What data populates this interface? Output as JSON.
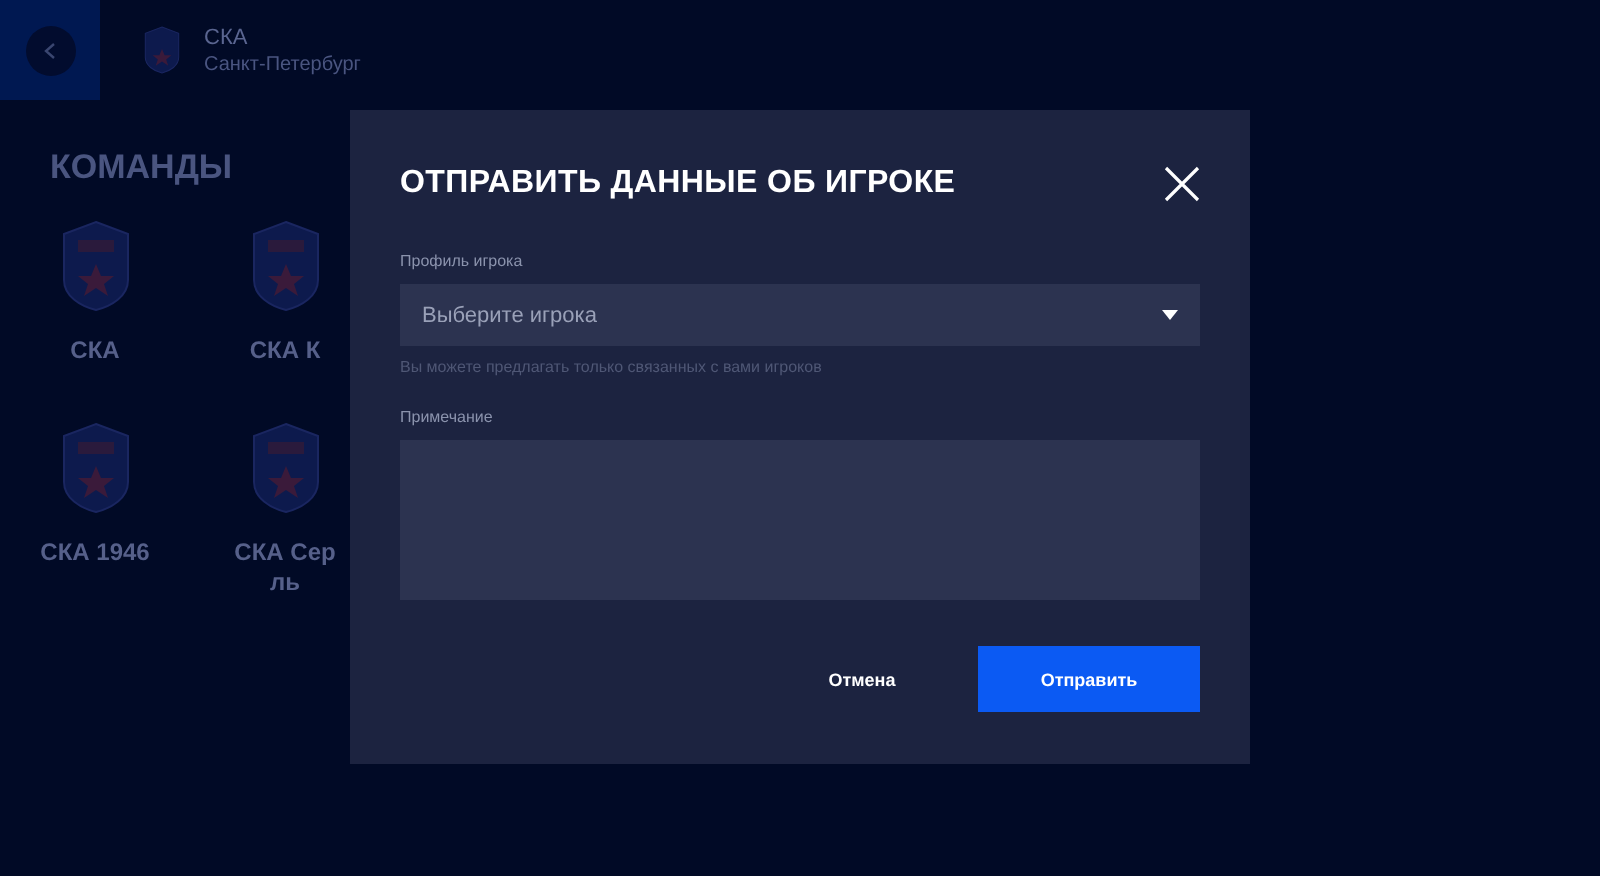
{
  "header": {
    "team_name": "СКА",
    "city": "Санкт-Петербург"
  },
  "section_title": "КОМАНДЫ",
  "teams": [
    {
      "lines": [
        "СКА"
      ]
    },
    {
      "lines": [
        "СКА К"
      ]
    },
    {
      "lines": [
        "СКА 1946"
      ]
    },
    {
      "lines": [
        "СКА Сер",
        "ль"
      ]
    }
  ],
  "dialog": {
    "title": "ОТПРАВИТЬ ДАННЫЕ ОБ ИГРОКЕ",
    "fields": [
      {
        "kind": "select",
        "label": "Профиль игрока",
        "placeholder": "Выберите игрока",
        "hint": "Вы можете предлагать только связанных с вами игроков"
      },
      {
        "kind": "textarea",
        "label": "Примечание"
      }
    ],
    "buttons": [
      {
        "label": "Отмена",
        "kind": "text"
      },
      {
        "label": "Отправить",
        "kind": "primary"
      }
    ]
  }
}
